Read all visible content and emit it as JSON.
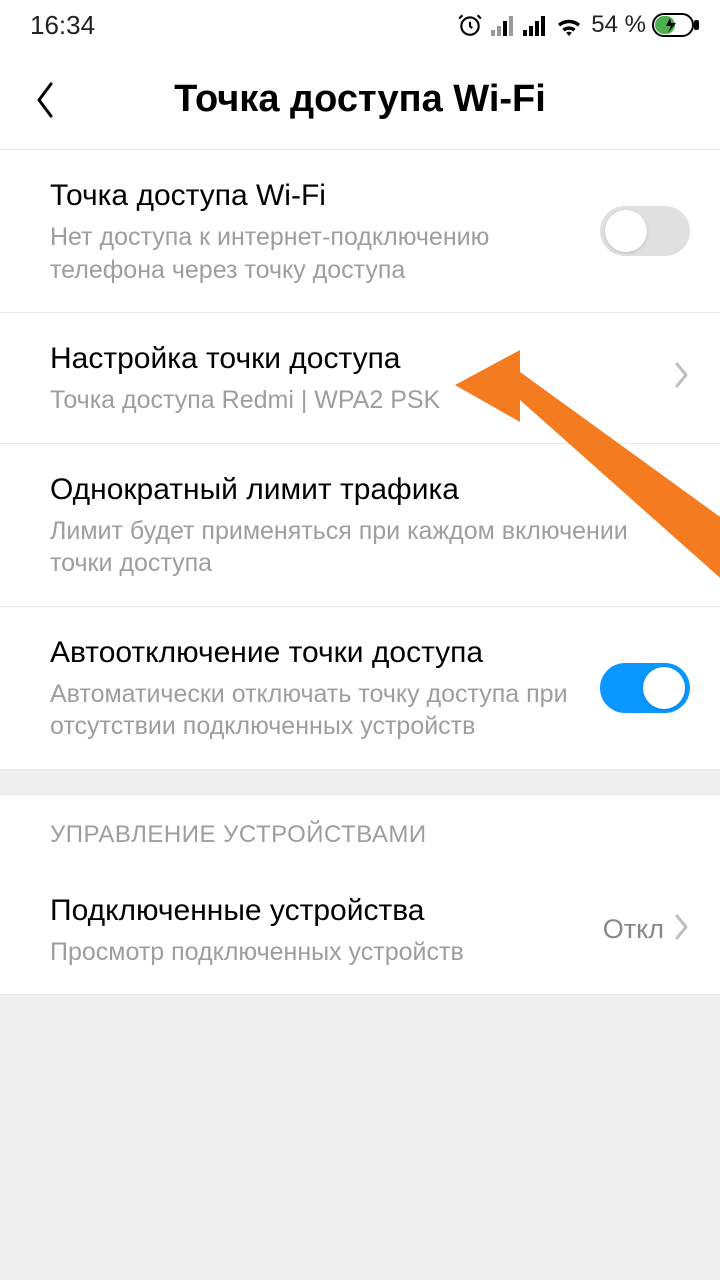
{
  "statusbar": {
    "time": "16:34",
    "battery_text": "54 %"
  },
  "header": {
    "title": "Точка доступа Wi-Fi"
  },
  "items": {
    "hotspot": {
      "title": "Точка доступа Wi-Fi",
      "subtitle": "Нет доступа к интернет-подключению телефона через точку доступа"
    },
    "setup": {
      "title": "Настройка точки доступа",
      "subtitle": "Точка доступа Redmi | WPA2 PSK"
    },
    "limit": {
      "title": "Однократный лимит трафика",
      "subtitle": "Лимит будет применяться при каждом включении точки доступа"
    },
    "autooff": {
      "title": "Автоотключение точки доступа",
      "subtitle": "Автоматически отключать точку доступа при отсутствии подключенных устройств"
    }
  },
  "section": {
    "device_mgmt": "УПРАВЛЕНИЕ УСТРОЙСТВАМИ"
  },
  "devices": {
    "title": "Подключенные устройства",
    "subtitle": "Просмотр подключенных устройств",
    "value": "Откл"
  }
}
